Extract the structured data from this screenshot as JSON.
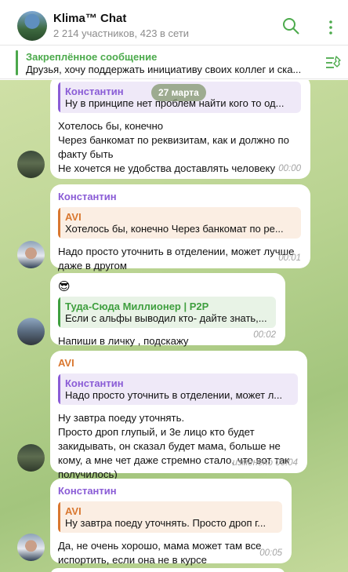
{
  "header": {
    "title": "Klima™ Chat",
    "subtitle": "2 214 участников, 423 в сети"
  },
  "pinned": {
    "title": "Закреплённое сообщение",
    "text": "Друзья, хочу поддержать инициативу своих коллег и ска..."
  },
  "date_badge": "27 марта",
  "messages": [
    {
      "quote": {
        "name": "Константин",
        "text": "Ну в принципе нет проблем найти кого то од..."
      },
      "lines": [
        "Хотелось бы, конечно",
        "Через банкомат по реквизитам, как и должно по",
        "факту быть",
        "Не хочется не удобства доставлять человеку"
      ],
      "time": "00:00"
    },
    {
      "sender": "Константин",
      "quote": {
        "name": "AVI",
        "text": "Хотелось бы, конечно  Через банкомат по ре..."
      },
      "lines": [
        "Надо просто уточнить в отделении, может лучше",
        "даже в другом"
      ],
      "time": "00:01"
    },
    {
      "sender": "😎",
      "quote": {
        "name": "Туда-Сюда Миллионер | P2P",
        "text": "Если с альфы выводил кто- дайте знать,..."
      },
      "lines": [
        "Напиши в личку , подскажу"
      ],
      "time": "00:02"
    },
    {
      "sender": "AVI",
      "quote": {
        "name": "Константин",
        "text": "Надо просто уточнить в отделении, может л..."
      },
      "lines": [
        "Ну завтра поеду уточнять.",
        "Просто дроп глупый, и 3е лицо кто будет",
        "закидывать, он сказал будет мама, больше не",
        "кому, а мне чет даже стремно стало, что вот так",
        "получилось)"
      ],
      "time": "изменено 00:04"
    },
    {
      "sender": "Константин",
      "quote": {
        "name": "AVI",
        "text": "Ну завтра поеду уточнять.  Просто дроп г..."
      },
      "lines": [
        "Да, не очень хорошо, мама может там все",
        "испортить, если она не в курсе"
      ],
      "time": "00:05"
    }
  ],
  "colors": {
    "accent": "#4caa4c",
    "sender_purple": "#8a5cd6",
    "sender_orange": "#d9772f",
    "sender_green": "#3f9f3f"
  },
  "icons": [
    "search-icon",
    "more-vertical-icon",
    "pinned-list-icon"
  ]
}
